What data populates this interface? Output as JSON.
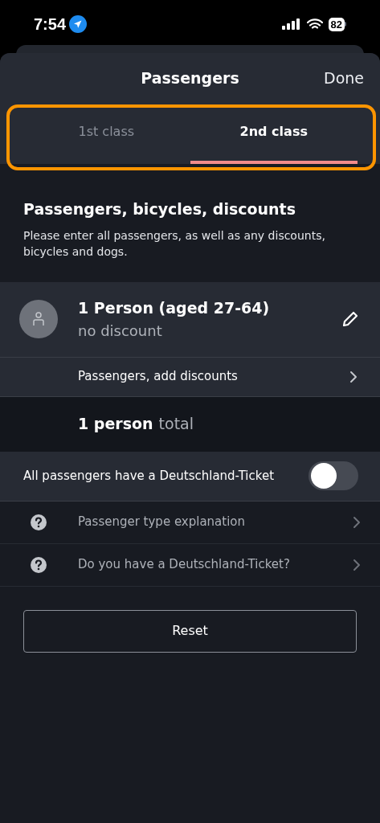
{
  "status_bar": {
    "time": "7:54",
    "battery": "82"
  },
  "header": {
    "title": "Passengers",
    "done": "Done"
  },
  "tabs": [
    {
      "label": "1st class",
      "selected": false
    },
    {
      "label": "2nd class",
      "selected": true
    }
  ],
  "section": {
    "title": "Passengers, bicycles, discounts",
    "description": "Please enter all passengers, as well as any discounts, bicycles and dogs."
  },
  "passenger": {
    "title": "1 Person (aged 27-64)",
    "subtitle": "no discount"
  },
  "add_discounts": "Passengers, add discounts",
  "total": {
    "count": "1 person",
    "label": "total"
  },
  "deutschland_toggle": {
    "label": "All passengers have a Deutschland-Ticket",
    "on": false
  },
  "help_items": [
    "Passenger type explanation",
    "Do you have a Deutschland-Ticket?"
  ],
  "reset_button": "Reset"
}
